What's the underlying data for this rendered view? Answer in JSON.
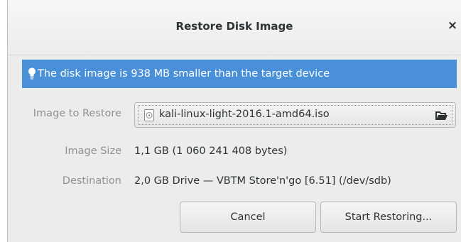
{
  "dialog": {
    "title": "Restore Disk Image",
    "close_label": "×"
  },
  "info": {
    "icon": "lightbulb-icon",
    "message": "The disk image is 938 MB smaller than the target device",
    "color": "#4a90d9"
  },
  "form": {
    "image_to_restore_label": "Image to Restore",
    "file_name": "kali-linux-light-2016.1-amd64.iso",
    "image_size_label": "Image Size",
    "image_size_value": "1,1 GB (1 060 241 408 bytes)",
    "destination_label": "Destination",
    "destination_value": "2,0 GB Drive — VBTM Store'n'go [6.51] (/dev/sdb)"
  },
  "buttons": {
    "cancel": "Cancel",
    "start": "Start Restoring..."
  }
}
